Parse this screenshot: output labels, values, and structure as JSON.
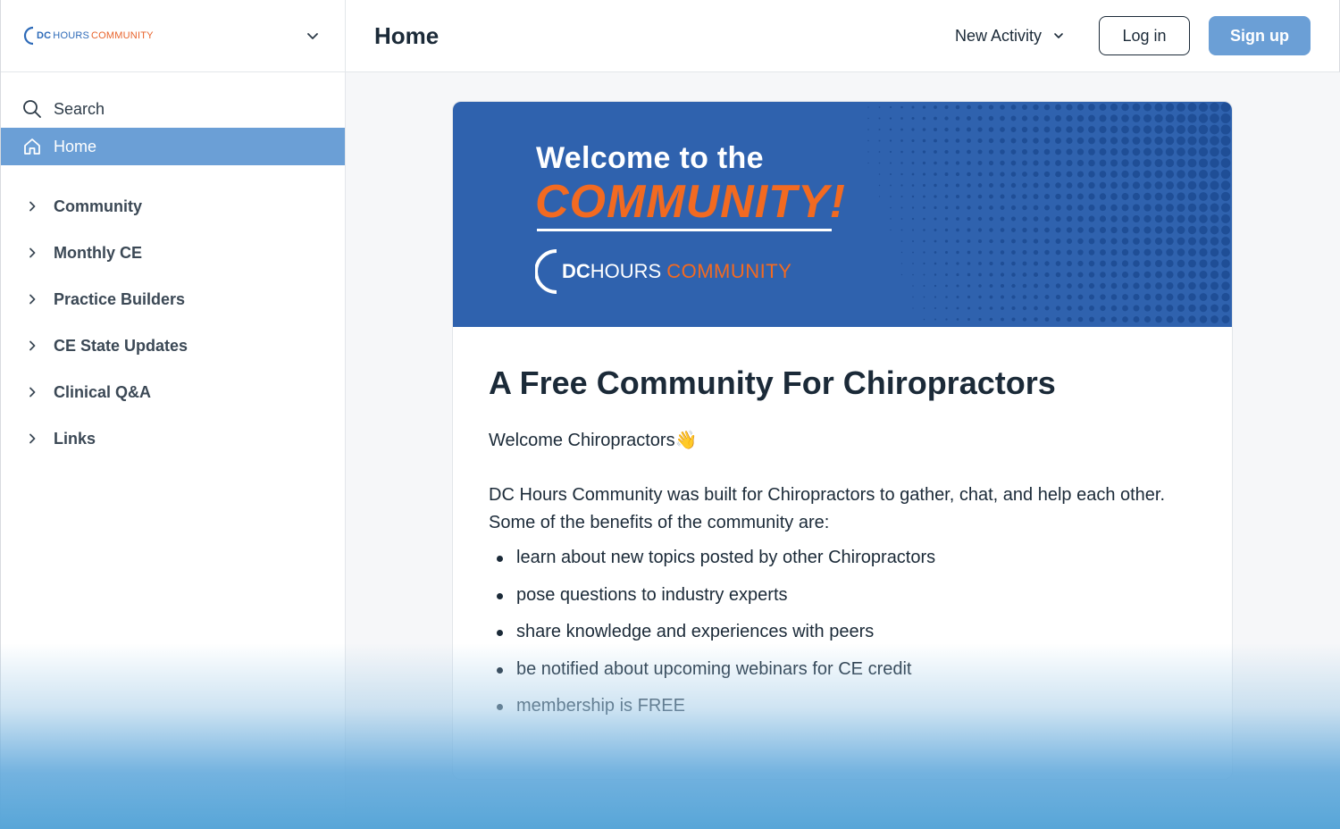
{
  "sidebar": {
    "logo": {
      "dc": "DC",
      "hours": "HOURS",
      "community": "COMMUNITY"
    },
    "search_label": "Search",
    "home_label": "Home",
    "categories": [
      "Community",
      "Monthly CE",
      "Practice Builders",
      "CE State Updates",
      "Clinical Q&A",
      "Links"
    ]
  },
  "header": {
    "title": "Home",
    "activity_label": "New Activity",
    "login_label": "Log in",
    "signup_label": "Sign up"
  },
  "banner": {
    "welcome": "Welcome to the",
    "community": "COMMUNITY!",
    "logo_dc": "DC",
    "logo_hours": "HOURS",
    "logo_community": "COMMUNITY"
  },
  "post": {
    "heading": "A Free Community For Chiropractors",
    "greeting": "Welcome Chiropractors👋",
    "intro": "DC Hours Community was built for Chiropractors to gather, chat, and help each other.  Some of the benefits of the community are:",
    "bullets": [
      "learn about new topics posted by other Chiropractors",
      "pose questions to industry experts",
      "share knowledge and experiences with peers",
      "be notified about upcoming webinars for CE credit",
      "membership is FREE"
    ]
  },
  "colors": {
    "accent": "#6b9fd6",
    "banner_blue": "#2f62ae",
    "banner_orange": "#f26a21"
  },
  "icons": {
    "search": "search-icon",
    "home": "home-icon",
    "chevron_right": "chevron-right-icon",
    "chevron_down": "chevron-down-icon"
  }
}
